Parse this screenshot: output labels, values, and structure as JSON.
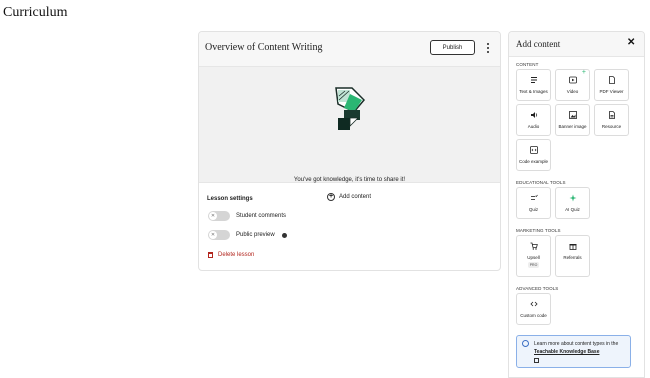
{
  "page": {
    "title": "Curriculum"
  },
  "lesson": {
    "title": "Overview of Content Writing",
    "publish_label": "Publish",
    "empty_message": "You've got knowledge, it's time to share it!",
    "add_content_label": "Add content",
    "settings_heading": "Lesson settings",
    "student_comments_label": "Student comments",
    "public_preview_label": "Public preview",
    "delete_label": "Delete lesson"
  },
  "panel": {
    "title": "Add content",
    "close_icon": "✕",
    "sections": {
      "content": "CONTENT",
      "educational": "EDUCATIONAL TOOLS",
      "marketing": "MARKETING TOOLS",
      "advanced": "ADVANCED TOOLS"
    },
    "tiles": {
      "text_images": "Text & Images",
      "video": "Video",
      "pdf_viewer": "PDF Viewer",
      "audio": "Audio",
      "banner_image": "Banner image",
      "resource": "Resource",
      "code_example": "Code example",
      "quiz": "Quiz",
      "ai_quiz": "AI Quiz",
      "upsell": "Upsell",
      "upsell_badge": "PRO",
      "referrals": "Referrals",
      "custom_code": "Custom code"
    },
    "info_text": "Learn more about content types in the",
    "info_link": "Teachable Knowledge Base"
  },
  "colors": {
    "accent_green": "#2bb673",
    "danger": "#b3261e",
    "info_border": "#8ab0e8"
  }
}
